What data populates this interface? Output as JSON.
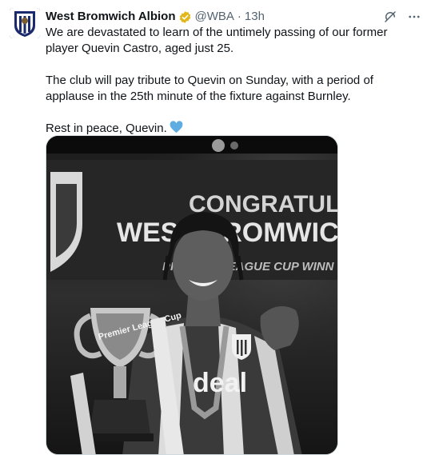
{
  "tweet": {
    "author": {
      "name": "West Bromwich Albion",
      "handle": "@WBA",
      "verified": true,
      "verified_color": "#e2b719"
    },
    "separator": "·",
    "timestamp": "13h",
    "paragraphs": [
      "We are devastated to learn of the untimely passing of our former player Quevin Castro, aged just 25.",
      "The club will pay tribute to Quevin on Sunday, with a period of applause in the 25th minute of the fixture against Burnley.",
      "Rest in peace, Quevin."
    ],
    "emoji": "blue-heart",
    "emoji_color": "#5dade2",
    "media": {
      "type": "black-and-white photo",
      "banner_lines": [
        "CONGRATULATI",
        "WEST BROMWICH",
        "PREMIER LEAGUE CUP WINN"
      ],
      "shirt_sponsor": "deal",
      "trophy_text": "Premier League Cup"
    },
    "icons": [
      "grok-icon",
      "more-icon",
      "verified-badge-icon",
      "blue-heart-icon"
    ]
  }
}
